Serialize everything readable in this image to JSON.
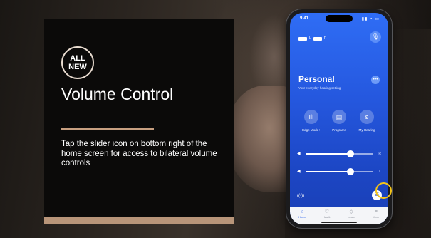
{
  "slide": {
    "badge_line1": "ALL",
    "badge_line2": "NEW",
    "title": "Volume Control",
    "description": "Tap the slider icon on bottom right of the home screen for access to bilateral volume controls",
    "accent_color": "#c79f80",
    "highlight_color": "#f5c518"
  },
  "phone": {
    "status": {
      "time": "9:41"
    },
    "battery": {
      "left_label": "L",
      "right_label": "R"
    },
    "program": {
      "name": "Personal",
      "subtitle": "Your everyday hearing setting"
    },
    "features": [
      {
        "label": "Edge Mode+",
        "icon": "waveform-icon"
      },
      {
        "label": "Programs",
        "icon": "programs-icon"
      },
      {
        "label": "My Hearing",
        "icon": "ear-icon"
      }
    ],
    "sliders": [
      {
        "side": "R",
        "level": 0.67
      },
      {
        "side": "L",
        "level": 0.67
      }
    ],
    "tabs": [
      {
        "label": "Home",
        "icon": "home-icon",
        "active": true
      },
      {
        "label": "Health",
        "icon": "health-icon",
        "active": false
      },
      {
        "label": "Learn",
        "icon": "learn-icon",
        "active": false
      },
      {
        "label": "More",
        "icon": "menu-icon",
        "active": false
      }
    ]
  }
}
